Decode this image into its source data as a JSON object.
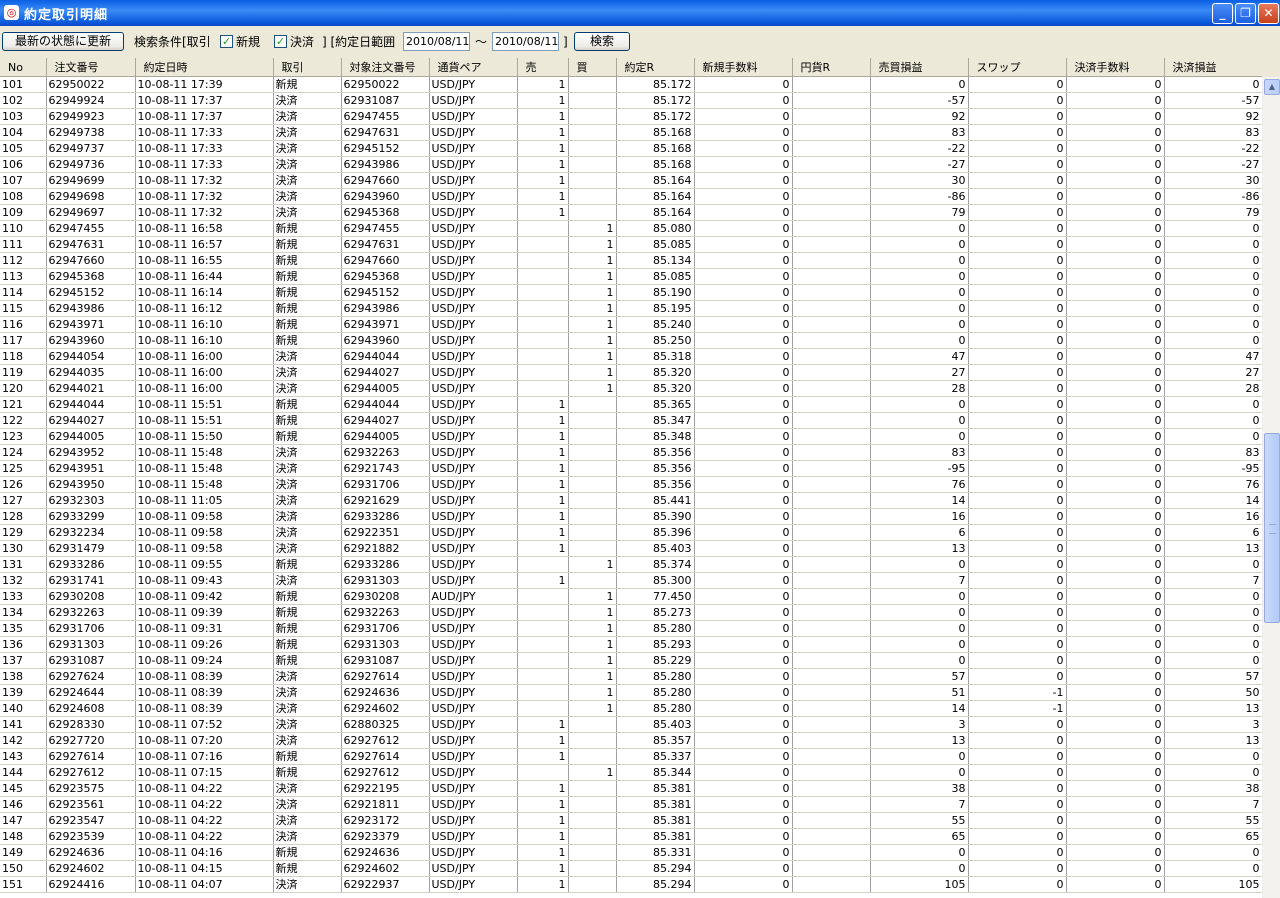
{
  "window": {
    "title": "約定取引明細"
  },
  "toolbar": {
    "refresh_label": "最新の状態に更新",
    "search_condition_label": "検索条件[取引",
    "new_label": "新規",
    "new_checked": true,
    "settle_label": "決済",
    "settle_checked": true,
    "range_label": "] [約定日範囲",
    "date_from": "2010/08/11",
    "tilde": "～",
    "date_to": "2010/08/11",
    "range_close": "]",
    "search_label": "検索"
  },
  "table": {
    "columns": [
      "No",
      "注文番号",
      "約定日時",
      "取引",
      "対象注文番号",
      "通貨ペア",
      "売",
      "買",
      "約定R",
      "新規手数料",
      "円貨R",
      "売買損益",
      "スワップ",
      "決済手数料",
      "決済損益"
    ],
    "rows": [
      [
        "101",
        "62950022",
        "10-08-11 17:39",
        "新規",
        "62950022",
        "USD/JPY",
        "1",
        "",
        "85.172",
        "0",
        "",
        "0",
        "0",
        "0",
        "0"
      ],
      [
        "102",
        "62949924",
        "10-08-11 17:37",
        "決済",
        "62931087",
        "USD/JPY",
        "1",
        "",
        "85.172",
        "0",
        "",
        "-57",
        "0",
        "0",
        "-57"
      ],
      [
        "103",
        "62949923",
        "10-08-11 17:37",
        "決済",
        "62947455",
        "USD/JPY",
        "1",
        "",
        "85.172",
        "0",
        "",
        "92",
        "0",
        "0",
        "92"
      ],
      [
        "104",
        "62949738",
        "10-08-11 17:33",
        "決済",
        "62947631",
        "USD/JPY",
        "1",
        "",
        "85.168",
        "0",
        "",
        "83",
        "0",
        "0",
        "83"
      ],
      [
        "105",
        "62949737",
        "10-08-11 17:33",
        "決済",
        "62945152",
        "USD/JPY",
        "1",
        "",
        "85.168",
        "0",
        "",
        "-22",
        "0",
        "0",
        "-22"
      ],
      [
        "106",
        "62949736",
        "10-08-11 17:33",
        "決済",
        "62943986",
        "USD/JPY",
        "1",
        "",
        "85.168",
        "0",
        "",
        "-27",
        "0",
        "0",
        "-27"
      ],
      [
        "107",
        "62949699",
        "10-08-11 17:32",
        "決済",
        "62947660",
        "USD/JPY",
        "1",
        "",
        "85.164",
        "0",
        "",
        "30",
        "0",
        "0",
        "30"
      ],
      [
        "108",
        "62949698",
        "10-08-11 17:32",
        "決済",
        "62943960",
        "USD/JPY",
        "1",
        "",
        "85.164",
        "0",
        "",
        "-86",
        "0",
        "0",
        "-86"
      ],
      [
        "109",
        "62949697",
        "10-08-11 17:32",
        "決済",
        "62945368",
        "USD/JPY",
        "1",
        "",
        "85.164",
        "0",
        "",
        "79",
        "0",
        "0",
        "79"
      ],
      [
        "110",
        "62947455",
        "10-08-11 16:58",
        "新規",
        "62947455",
        "USD/JPY",
        "",
        "1",
        "85.080",
        "0",
        "",
        "0",
        "0",
        "0",
        "0"
      ],
      [
        "111",
        "62947631",
        "10-08-11 16:57",
        "新規",
        "62947631",
        "USD/JPY",
        "",
        "1",
        "85.085",
        "0",
        "",
        "0",
        "0",
        "0",
        "0"
      ],
      [
        "112",
        "62947660",
        "10-08-11 16:55",
        "新規",
        "62947660",
        "USD/JPY",
        "",
        "1",
        "85.134",
        "0",
        "",
        "0",
        "0",
        "0",
        "0"
      ],
      [
        "113",
        "62945368",
        "10-08-11 16:44",
        "新規",
        "62945368",
        "USD/JPY",
        "",
        "1",
        "85.085",
        "0",
        "",
        "0",
        "0",
        "0",
        "0"
      ],
      [
        "114",
        "62945152",
        "10-08-11 16:14",
        "新規",
        "62945152",
        "USD/JPY",
        "",
        "1",
        "85.190",
        "0",
        "",
        "0",
        "0",
        "0",
        "0"
      ],
      [
        "115",
        "62943986",
        "10-08-11 16:12",
        "新規",
        "62943986",
        "USD/JPY",
        "",
        "1",
        "85.195",
        "0",
        "",
        "0",
        "0",
        "0",
        "0"
      ],
      [
        "116",
        "62943971",
        "10-08-11 16:10",
        "新規",
        "62943971",
        "USD/JPY",
        "",
        "1",
        "85.240",
        "0",
        "",
        "0",
        "0",
        "0",
        "0"
      ],
      [
        "117",
        "62943960",
        "10-08-11 16:10",
        "新規",
        "62943960",
        "USD/JPY",
        "",
        "1",
        "85.250",
        "0",
        "",
        "0",
        "0",
        "0",
        "0"
      ],
      [
        "118",
        "62944054",
        "10-08-11 16:00",
        "決済",
        "62944044",
        "USD/JPY",
        "",
        "1",
        "85.318",
        "0",
        "",
        "47",
        "0",
        "0",
        "47"
      ],
      [
        "119",
        "62944035",
        "10-08-11 16:00",
        "決済",
        "62944027",
        "USD/JPY",
        "",
        "1",
        "85.320",
        "0",
        "",
        "27",
        "0",
        "0",
        "27"
      ],
      [
        "120",
        "62944021",
        "10-08-11 16:00",
        "決済",
        "62944005",
        "USD/JPY",
        "",
        "1",
        "85.320",
        "0",
        "",
        "28",
        "0",
        "0",
        "28"
      ],
      [
        "121",
        "62944044",
        "10-08-11 15:51",
        "新規",
        "62944044",
        "USD/JPY",
        "1",
        "",
        "85.365",
        "0",
        "",
        "0",
        "0",
        "0",
        "0"
      ],
      [
        "122",
        "62944027",
        "10-08-11 15:51",
        "新規",
        "62944027",
        "USD/JPY",
        "1",
        "",
        "85.347",
        "0",
        "",
        "0",
        "0",
        "0",
        "0"
      ],
      [
        "123",
        "62944005",
        "10-08-11 15:50",
        "新規",
        "62944005",
        "USD/JPY",
        "1",
        "",
        "85.348",
        "0",
        "",
        "0",
        "0",
        "0",
        "0"
      ],
      [
        "124",
        "62943952",
        "10-08-11 15:48",
        "決済",
        "62932263",
        "USD/JPY",
        "1",
        "",
        "85.356",
        "0",
        "",
        "83",
        "0",
        "0",
        "83"
      ],
      [
        "125",
        "62943951",
        "10-08-11 15:48",
        "決済",
        "62921743",
        "USD/JPY",
        "1",
        "",
        "85.356",
        "0",
        "",
        "-95",
        "0",
        "0",
        "-95"
      ],
      [
        "126",
        "62943950",
        "10-08-11 15:48",
        "決済",
        "62931706",
        "USD/JPY",
        "1",
        "",
        "85.356",
        "0",
        "",
        "76",
        "0",
        "0",
        "76"
      ],
      [
        "127",
        "62932303",
        "10-08-11 11:05",
        "決済",
        "62921629",
        "USD/JPY",
        "1",
        "",
        "85.441",
        "0",
        "",
        "14",
        "0",
        "0",
        "14"
      ],
      [
        "128",
        "62933299",
        "10-08-11 09:58",
        "決済",
        "62933286",
        "USD/JPY",
        "1",
        "",
        "85.390",
        "0",
        "",
        "16",
        "0",
        "0",
        "16"
      ],
      [
        "129",
        "62932234",
        "10-08-11 09:58",
        "決済",
        "62922351",
        "USD/JPY",
        "1",
        "",
        "85.396",
        "0",
        "",
        "6",
        "0",
        "0",
        "6"
      ],
      [
        "130",
        "62931479",
        "10-08-11 09:58",
        "決済",
        "62921882",
        "USD/JPY",
        "1",
        "",
        "85.403",
        "0",
        "",
        "13",
        "0",
        "0",
        "13"
      ],
      [
        "131",
        "62933286",
        "10-08-11 09:55",
        "新規",
        "62933286",
        "USD/JPY",
        "",
        "1",
        "85.374",
        "0",
        "",
        "0",
        "0",
        "0",
        "0"
      ],
      [
        "132",
        "62931741",
        "10-08-11 09:43",
        "決済",
        "62931303",
        "USD/JPY",
        "1",
        "",
        "85.300",
        "0",
        "",
        "7",
        "0",
        "0",
        "7"
      ],
      [
        "133",
        "62930208",
        "10-08-11 09:42",
        "新規",
        "62930208",
        "AUD/JPY",
        "",
        "1",
        "77.450",
        "0",
        "",
        "0",
        "0",
        "0",
        "0"
      ],
      [
        "134",
        "62932263",
        "10-08-11 09:39",
        "新規",
        "62932263",
        "USD/JPY",
        "",
        "1",
        "85.273",
        "0",
        "",
        "0",
        "0",
        "0",
        "0"
      ],
      [
        "135",
        "62931706",
        "10-08-11 09:31",
        "新規",
        "62931706",
        "USD/JPY",
        "",
        "1",
        "85.280",
        "0",
        "",
        "0",
        "0",
        "0",
        "0"
      ],
      [
        "136",
        "62931303",
        "10-08-11 09:26",
        "新規",
        "62931303",
        "USD/JPY",
        "",
        "1",
        "85.293",
        "0",
        "",
        "0",
        "0",
        "0",
        "0"
      ],
      [
        "137",
        "62931087",
        "10-08-11 09:24",
        "新規",
        "62931087",
        "USD/JPY",
        "",
        "1",
        "85.229",
        "0",
        "",
        "0",
        "0",
        "0",
        "0"
      ],
      [
        "138",
        "62927624",
        "10-08-11 08:39",
        "決済",
        "62927614",
        "USD/JPY",
        "",
        "1",
        "85.280",
        "0",
        "",
        "57",
        "0",
        "0",
        "57"
      ],
      [
        "139",
        "62924644",
        "10-08-11 08:39",
        "決済",
        "62924636",
        "USD/JPY",
        "",
        "1",
        "85.280",
        "0",
        "",
        "51",
        "-1",
        "0",
        "50"
      ],
      [
        "140",
        "62924608",
        "10-08-11 08:39",
        "決済",
        "62924602",
        "USD/JPY",
        "",
        "1",
        "85.280",
        "0",
        "",
        "14",
        "-1",
        "0",
        "13"
      ],
      [
        "141",
        "62928330",
        "10-08-11 07:52",
        "決済",
        "62880325",
        "USD/JPY",
        "1",
        "",
        "85.403",
        "0",
        "",
        "3",
        "0",
        "0",
        "3"
      ],
      [
        "142",
        "62927720",
        "10-08-11 07:20",
        "決済",
        "62927612",
        "USD/JPY",
        "1",
        "",
        "85.357",
        "0",
        "",
        "13",
        "0",
        "0",
        "13"
      ],
      [
        "143",
        "62927614",
        "10-08-11 07:16",
        "新規",
        "62927614",
        "USD/JPY",
        "1",
        "",
        "85.337",
        "0",
        "",
        "0",
        "0",
        "0",
        "0"
      ],
      [
        "144",
        "62927612",
        "10-08-11 07:15",
        "新規",
        "62927612",
        "USD/JPY",
        "",
        "1",
        "85.344",
        "0",
        "",
        "0",
        "0",
        "0",
        "0"
      ],
      [
        "145",
        "62923575",
        "10-08-11 04:22",
        "決済",
        "62922195",
        "USD/JPY",
        "1",
        "",
        "85.381",
        "0",
        "",
        "38",
        "0",
        "0",
        "38"
      ],
      [
        "146",
        "62923561",
        "10-08-11 04:22",
        "決済",
        "62921811",
        "USD/JPY",
        "1",
        "",
        "85.381",
        "0",
        "",
        "7",
        "0",
        "0",
        "7"
      ],
      [
        "147",
        "62923547",
        "10-08-11 04:22",
        "決済",
        "62923172",
        "USD/JPY",
        "1",
        "",
        "85.381",
        "0",
        "",
        "55",
        "0",
        "0",
        "55"
      ],
      [
        "148",
        "62923539",
        "10-08-11 04:22",
        "決済",
        "62923379",
        "USD/JPY",
        "1",
        "",
        "85.381",
        "0",
        "",
        "65",
        "0",
        "0",
        "65"
      ],
      [
        "149",
        "62924636",
        "10-08-11 04:16",
        "新規",
        "62924636",
        "USD/JPY",
        "1",
        "",
        "85.331",
        "0",
        "",
        "0",
        "0",
        "0",
        "0"
      ],
      [
        "150",
        "62924602",
        "10-08-11 04:15",
        "新規",
        "62924602",
        "USD/JPY",
        "1",
        "",
        "85.294",
        "0",
        "",
        "0",
        "0",
        "0",
        "0"
      ],
      [
        "151",
        "62924416",
        "10-08-11 04:07",
        "決済",
        "62922937",
        "USD/JPY",
        "1",
        "",
        "85.294",
        "0",
        "",
        "105",
        "0",
        "0",
        "105"
      ]
    ]
  }
}
